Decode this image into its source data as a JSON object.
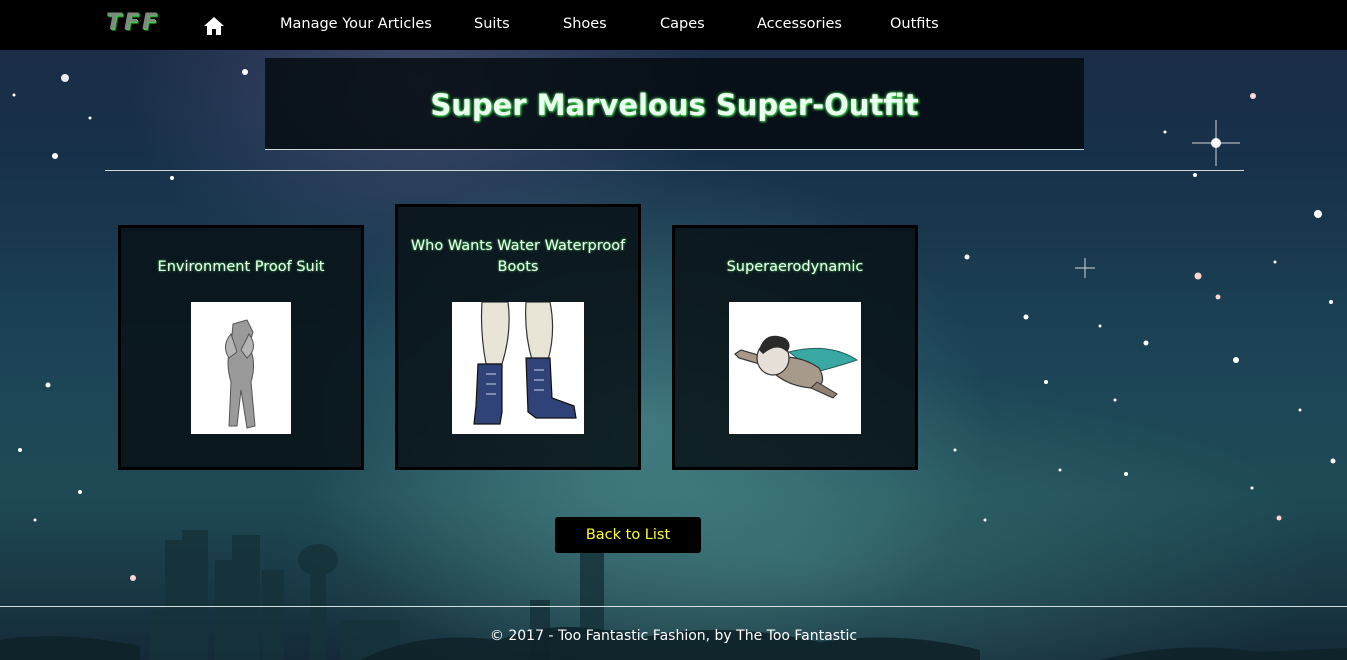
{
  "nav": {
    "brand": "TFF",
    "home_icon": "home-icon",
    "items": [
      {
        "label": "Manage Your Articles"
      },
      {
        "label": "Suits"
      },
      {
        "label": "Shoes"
      },
      {
        "label": "Capes"
      },
      {
        "label": "Accessories"
      },
      {
        "label": "Outfits"
      }
    ]
  },
  "page": {
    "title": "Super Marvelous Super-Outfit"
  },
  "articles": [
    {
      "name": "Environment Proof Suit",
      "image": "suit-figure-image"
    },
    {
      "name": "Who Wants Water Waterproof Boots",
      "image": "boots-image"
    },
    {
      "name": "Superaerodynamic",
      "image": "flying-cape-hero-image"
    }
  ],
  "actions": {
    "back_label": "Back to List"
  },
  "footer": {
    "text": "© 2017 - Too Fantastic Fashion, by The Too Fantastic"
  },
  "colors": {
    "nav_bg": "#000000",
    "title_glow": "#5bff6a",
    "back_button_text": "#ffff33"
  }
}
